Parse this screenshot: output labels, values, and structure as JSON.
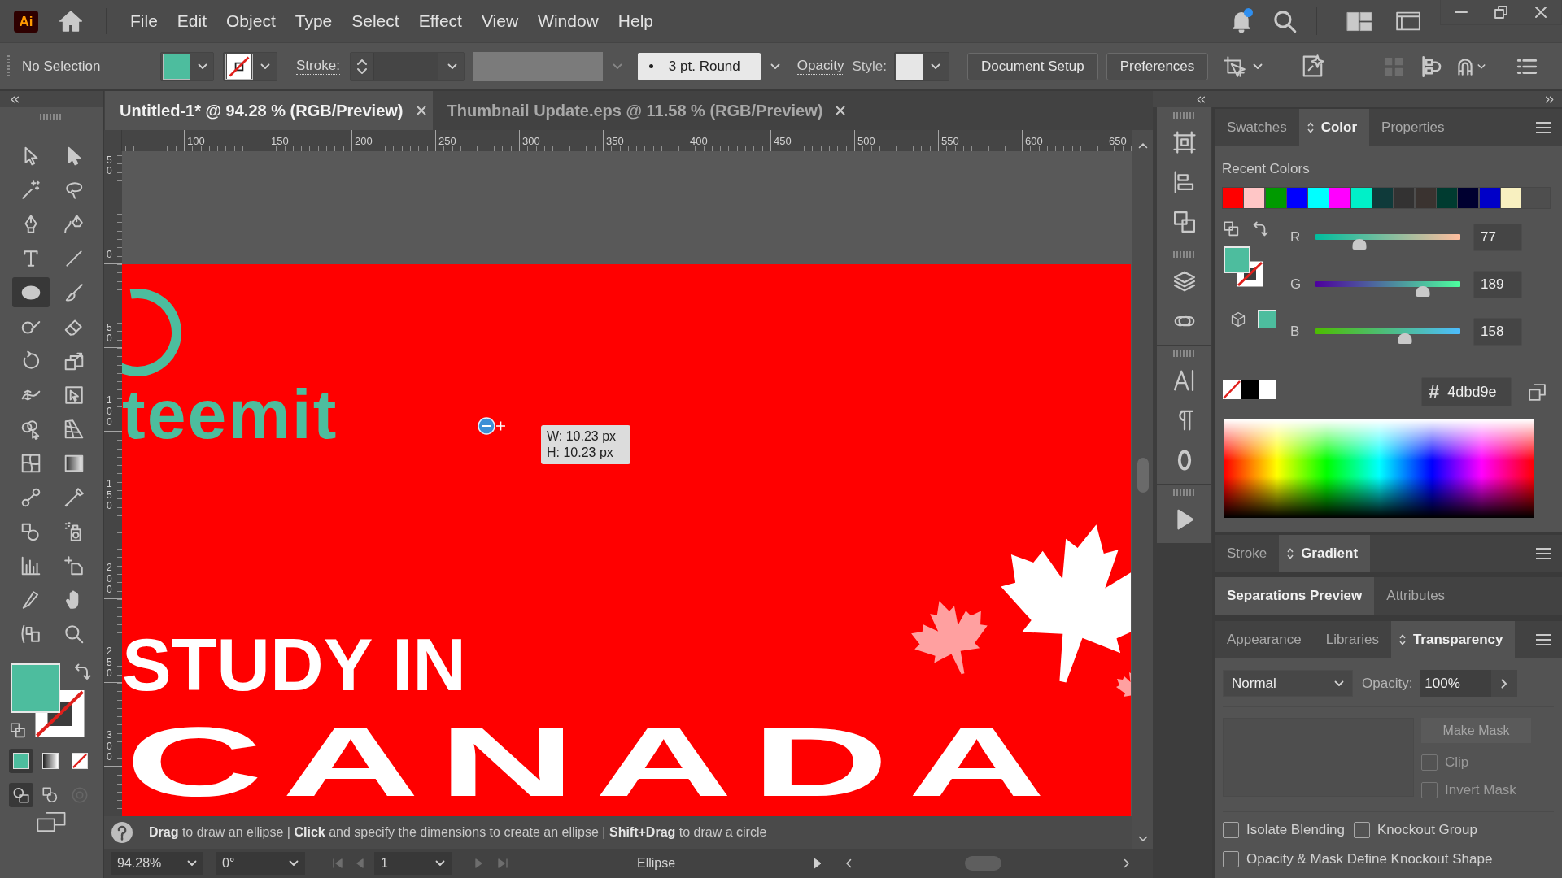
{
  "app": {
    "logo": "Ai"
  },
  "menu": [
    "File",
    "Edit",
    "Object",
    "Type",
    "Select",
    "Effect",
    "View",
    "Window",
    "Help"
  ],
  "control_bar": {
    "selection": "No Selection",
    "stroke_label": "Stroke:",
    "brush": "3 pt. Round",
    "opacity_label": "Opacity",
    "style_label": "Style:",
    "buttons": [
      "Document Setup",
      "Preferences"
    ]
  },
  "tools": [
    {
      "kind": "selection",
      "selected": false
    },
    {
      "kind": "direct-selection",
      "selected": false
    },
    {
      "kind": "magic-wand",
      "selected": false
    },
    {
      "kind": "lasso",
      "selected": false
    },
    {
      "kind": "pen",
      "selected": false
    },
    {
      "kind": "curvature",
      "selected": false
    },
    {
      "kind": "type",
      "selected": false
    },
    {
      "kind": "line",
      "selected": false
    },
    {
      "kind": "ellipse",
      "selected": true
    },
    {
      "kind": "paintbrush",
      "selected": false
    },
    {
      "kind": "shaper",
      "selected": false
    },
    {
      "kind": "eraser",
      "selected": false
    },
    {
      "kind": "rotate",
      "selected": false
    },
    {
      "kind": "scale",
      "selected": false
    },
    {
      "kind": "width",
      "selected": false
    },
    {
      "kind": "free-transform",
      "selected": false
    },
    {
      "kind": "shape-builder",
      "selected": false
    },
    {
      "kind": "perspective-grid",
      "selected": false
    },
    {
      "kind": "mesh",
      "selected": false
    },
    {
      "kind": "gradient",
      "selected": false
    },
    {
      "kind": "blend",
      "selected": false
    },
    {
      "kind": "eyedropper",
      "selected": false
    },
    {
      "kind": "live-paint",
      "selected": false
    },
    {
      "kind": "symbol-sprayer",
      "selected": false
    },
    {
      "kind": "graph",
      "selected": false
    },
    {
      "kind": "artboard",
      "selected": false
    },
    {
      "kind": "knife",
      "selected": false
    },
    {
      "kind": "hand",
      "selected": false
    },
    {
      "kind": "print-tiling",
      "selected": false
    },
    {
      "kind": "zoom",
      "selected": false
    }
  ],
  "color_modes": [
    {
      "kind": "color",
      "selected": true
    },
    {
      "kind": "gradient",
      "selected": false
    },
    {
      "kind": "none",
      "selected": false
    }
  ],
  "draw_modes": [
    {
      "kind": "normal",
      "selected": true,
      "disabled": false
    },
    {
      "kind": "behind",
      "selected": false,
      "disabled": false
    },
    {
      "kind": "inside",
      "selected": false,
      "disabled": true
    }
  ],
  "document_tabs": [
    {
      "label": "Untitled-1* @ 94.28 % (RGB/Preview)",
      "selected": true
    },
    {
      "label": "Thumbnail Update.eps @ 11.58 % (RGB/Preview)",
      "selected": false
    }
  ],
  "rulers": {
    "horizontal": [
      "100",
      "150",
      "200",
      "250",
      "300",
      "350",
      "400",
      "450",
      "500",
      "550",
      "600",
      "650"
    ],
    "vertical": [
      "50",
      "0",
      "50",
      "100",
      "150",
      "200",
      "250",
      "300"
    ]
  },
  "artboard": {
    "logo_text": "teemit",
    "headline": "STUDY IN",
    "title": "CANADA"
  },
  "size_tooltip": {
    "width": "W: 10.23 px",
    "height": "H: 10.23 px"
  },
  "status_hint": "**Drag** to draw an ellipse | **Click** and specify the dimensions to create an ellipse | **Shift+Drag** to draw a circle",
  "status_bar": {
    "zoom": "94.28%",
    "rotation": "0°",
    "artboard": "1",
    "current_tool": "Ellipse"
  },
  "color_panel": {
    "tabs": [
      {
        "label": "Swatches",
        "selected": false,
        "options_toggle": false
      },
      {
        "label": "Color",
        "selected": true,
        "options_toggle": true
      },
      {
        "label": "Properties",
        "selected": false,
        "options_toggle": false
      }
    ],
    "menu_button": true,
    "recent_label": "Recent Colors",
    "recent_colors": [
      {
        "color": "#ff0000"
      },
      {
        "color": "#ffc6c6"
      },
      {
        "color": "#009a00"
      },
      {
        "color": "#0000ff"
      },
      {
        "color": "#00ffff"
      },
      {
        "color": "#ff00ff"
      },
      {
        "color": "#00f0c8"
      },
      {
        "color": "#0f3a3a"
      },
      {
        "color": "#333232"
      },
      {
        "color": "#3a3330"
      },
      {
        "color": "#003b30"
      },
      {
        "color": "#000030"
      },
      {
        "color": "#0000c8"
      },
      {
        "color": "#f8f0c0"
      }
    ],
    "channels": [
      {
        "name": "R",
        "value": "77",
        "level": 0.302
      },
      {
        "name": "G",
        "value": "189",
        "level": 0.741
      },
      {
        "name": "B",
        "value": "158",
        "level": 0.62
      }
    ],
    "hex_symbol": "#",
    "hex": "4dbd9e"
  },
  "stroke_panel": {
    "tabs": [
      {
        "label": "Stroke",
        "selected": false,
        "options_toggle": false
      },
      {
        "label": "Gradient",
        "selected": true,
        "options_toggle": true
      }
    ],
    "menu_button": true
  },
  "separations_panel": {
    "tabs": [
      {
        "label": "Separations Preview",
        "selected": true,
        "options_toggle": false
      },
      {
        "label": "Attributes",
        "selected": false,
        "options_toggle": false
      }
    ],
    "menu_button": false
  },
  "transparency_panel": {
    "tabs": [
      {
        "label": "Appearance",
        "selected": false,
        "options_toggle": false
      },
      {
        "label": "Libraries",
        "selected": false,
        "options_toggle": false
      },
      {
        "label": "Transparency",
        "selected": true,
        "options_toggle": true
      }
    ],
    "menu_button": true,
    "blend_mode": "Normal",
    "opacity_label": "Opacity:",
    "opacity": "100%",
    "make_mask": {
      "label": "Make Mask",
      "disabled": true
    },
    "mask_options": [
      {
        "label": "Clip",
        "checked": false,
        "disabled": true
      },
      {
        "label": "Invert Mask",
        "checked": false,
        "disabled": true
      }
    ],
    "options": [
      {
        "label": "Isolate Blending",
        "checked": false
      },
      {
        "label": "Knockout Group",
        "checked": false
      },
      {
        "label": "Opacity & Mask Define Knockout Shape",
        "checked": false
      }
    ]
  }
}
